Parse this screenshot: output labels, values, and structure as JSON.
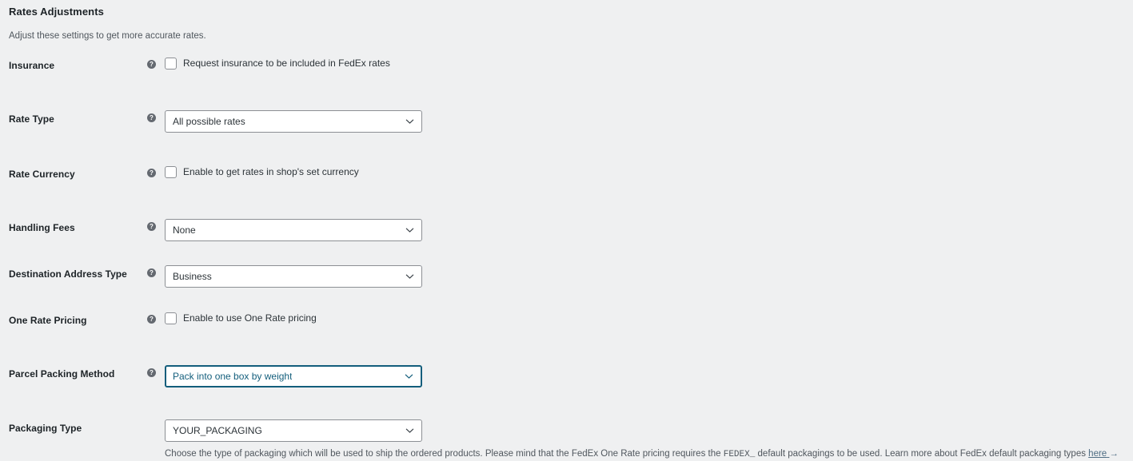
{
  "section": {
    "title": "Rates Adjustments",
    "subtitle": "Adjust these settings to get more accurate rates."
  },
  "help_icon_glyph": "?",
  "chevron_icon": "chevron-down-icon",
  "colors": {
    "background": "#eff0f1",
    "field_border": "#8c8f94",
    "focus_border": "#135e7c",
    "focus_text": "#135e7c",
    "label_text": "#1d2327",
    "body_text": "#50575e",
    "link": "#4f6d83",
    "help_icon_bg": "#646970"
  },
  "fields": {
    "insurance": {
      "label": "Insurance",
      "type": "checkbox",
      "checkbox_label": "Request insurance to be included in FedEx rates",
      "checked": false,
      "has_help": true
    },
    "rate_type": {
      "label": "Rate Type",
      "type": "select",
      "value": "All possible rates",
      "has_help": true,
      "focused": false
    },
    "rate_currency": {
      "label": "Rate Currency",
      "type": "checkbox",
      "checkbox_label": "Enable to get rates in shop's set currency",
      "checked": false,
      "has_help": true
    },
    "handling_fees": {
      "label": "Handling Fees",
      "type": "select",
      "value": "None",
      "has_help": true,
      "focused": false
    },
    "destination_address_type": {
      "label": "Destination Address Type",
      "type": "select",
      "value": "Business",
      "has_help": true,
      "focused": false
    },
    "one_rate_pricing": {
      "label": "One Rate Pricing",
      "type": "checkbox",
      "checkbox_label": "Enable to use One Rate pricing",
      "checked": false,
      "has_help": true
    },
    "parcel_packing_method": {
      "label": "Parcel Packing Method",
      "type": "select",
      "value": "Pack into one box by weight",
      "has_help": true,
      "focused": true
    },
    "packaging_type": {
      "label": "Packaging Type",
      "type": "select",
      "value": "YOUR_PACKAGING",
      "has_help": false,
      "focused": false,
      "description_part1": "Choose the type of packaging which will be used to ship the ordered products. Please mind that the FedEx One Rate pricing requires the ",
      "description_code": "FEDEX_",
      "description_part2": " default packagings to be used. Learn more about FedEx default packaging types ",
      "description_link": "here",
      "description_link_arrow": "→"
    }
  }
}
